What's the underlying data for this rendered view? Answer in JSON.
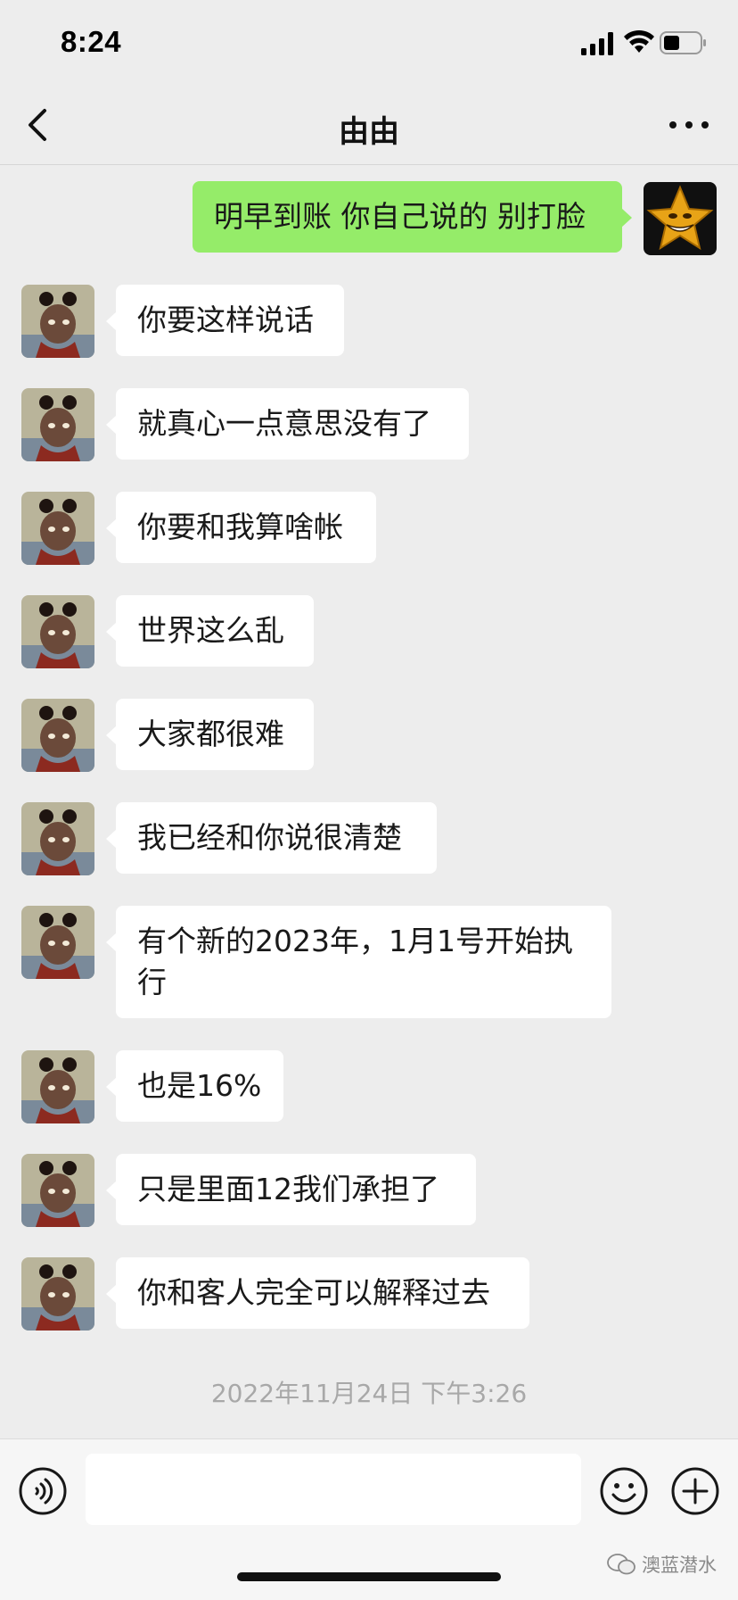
{
  "status_bar": {
    "time": "8:24"
  },
  "header": {
    "title": "由由"
  },
  "messages": [
    {
      "from": "me",
      "text": "明早到账 你自己说的 别打脸"
    },
    {
      "from": "contact",
      "text": "你要这样说话"
    },
    {
      "from": "contact",
      "text": "就真心一点意思没有了"
    },
    {
      "from": "contact",
      "text": "你要和我算啥帐"
    },
    {
      "from": "contact",
      "text": "世界这么乱"
    },
    {
      "from": "contact",
      "text": "大家都很难"
    },
    {
      "from": "contact",
      "text": "我已经和你说很清楚"
    },
    {
      "from": "contact",
      "text": "有个新的2023年，1月1号开始执行"
    },
    {
      "from": "contact",
      "text": "也是16%"
    },
    {
      "from": "contact",
      "text": "只是里面12我们承担了"
    },
    {
      "from": "contact",
      "text": "你和客人完全可以解释过去"
    }
  ],
  "timestamp": "2022年11月24日 下午3:26",
  "input_bar": {
    "value": ""
  },
  "watermark": {
    "text": "澳蓝潜水"
  },
  "colors": {
    "background": "#ededed",
    "outgoing_bubble": "#95ec69",
    "incoming_bubble": "#ffffff",
    "timestamp": "#a8a8a8"
  },
  "icons": {
    "back": "chevron-left-icon",
    "more": "more-dots-icon",
    "voice": "voice-icon",
    "emoji": "emoji-icon",
    "plus": "plus-icon"
  }
}
